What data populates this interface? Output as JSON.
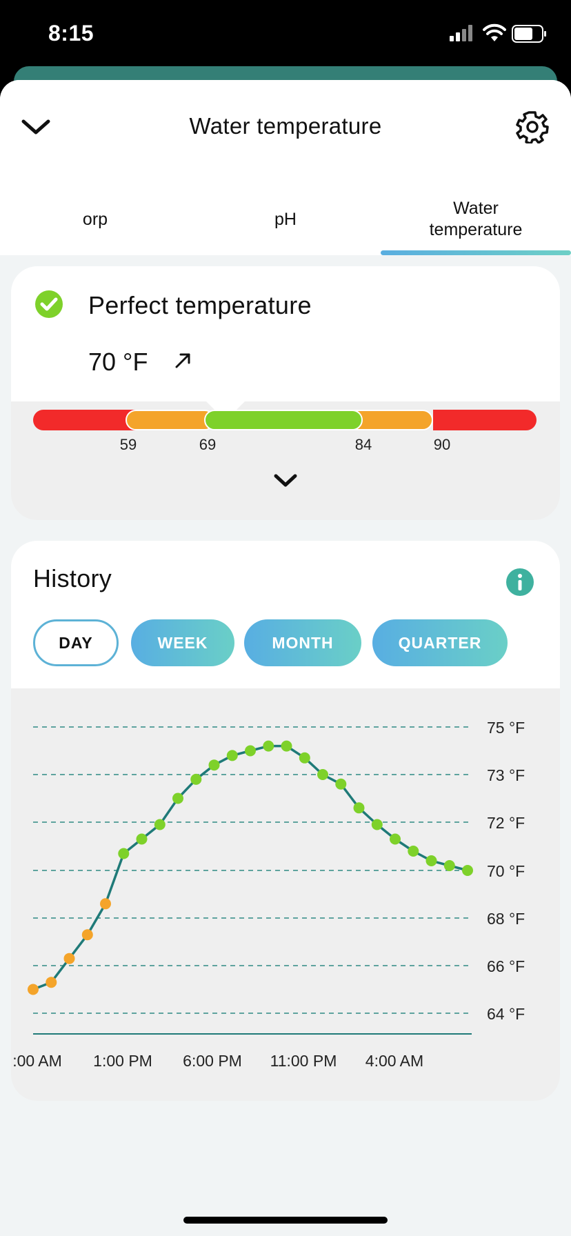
{
  "status_bar": {
    "time": "8:15"
  },
  "header": {
    "title": "Water temperature",
    "icons": {
      "collapse": "chevron-down-icon",
      "settings": "gear-icon"
    }
  },
  "tabs": [
    {
      "label": "orp"
    },
    {
      "label": "pH"
    },
    {
      "label": "Water temperature",
      "active": true
    }
  ],
  "status": {
    "label": "Perfect temperature",
    "value": "70 °F",
    "trend_icon": "arrow-up-right-icon",
    "range_ticks": [
      "59",
      "69",
      "84",
      "90"
    ],
    "colors": {
      "red": "#f22a2a",
      "orange": "#f4a42a",
      "green": "#7ed12a"
    }
  },
  "history": {
    "title": "History",
    "periods": [
      {
        "label": "DAY",
        "active": true
      },
      {
        "label": "WEEK"
      },
      {
        "label": "MONTH"
      },
      {
        "label": "QUARTER"
      }
    ]
  },
  "chart_data": {
    "type": "line",
    "y_ticks": [
      "75 °F",
      "73 °F",
      "72 °F",
      "70 °F",
      "68 °F",
      "66 °F",
      "64 °F"
    ],
    "y_values": [
      75,
      73,
      72,
      70,
      68,
      66,
      64
    ],
    "x_ticks": [
      ":00 AM",
      "1:00 PM",
      "6:00 PM",
      "11:00 PM",
      "4:00 AM"
    ],
    "grid": "dashed horizontal",
    "series": [
      {
        "values": [
          65.0,
          65.3,
          66.3,
          67.3,
          68.6,
          70.7,
          71.3,
          71.9,
          72.5,
          72.9,
          73.4,
          73.8,
          74.0,
          74.2,
          74.2,
          73.7,
          73.0,
          72.8,
          72.3,
          71.9,
          71.3,
          70.8,
          70.4,
          70.2,
          70.0
        ],
        "point_colors": [
          "orange",
          "orange",
          "orange",
          "orange",
          "orange",
          "green",
          "green",
          "green",
          "green",
          "green",
          "green",
          "green",
          "green",
          "green",
          "green",
          "green",
          "green",
          "green",
          "green",
          "green",
          "green",
          "green",
          "green",
          "green",
          "green"
        ]
      }
    ],
    "colors": {
      "line": "#1f7a78",
      "orange": "#f4a42a",
      "green": "#7ed12a"
    }
  }
}
